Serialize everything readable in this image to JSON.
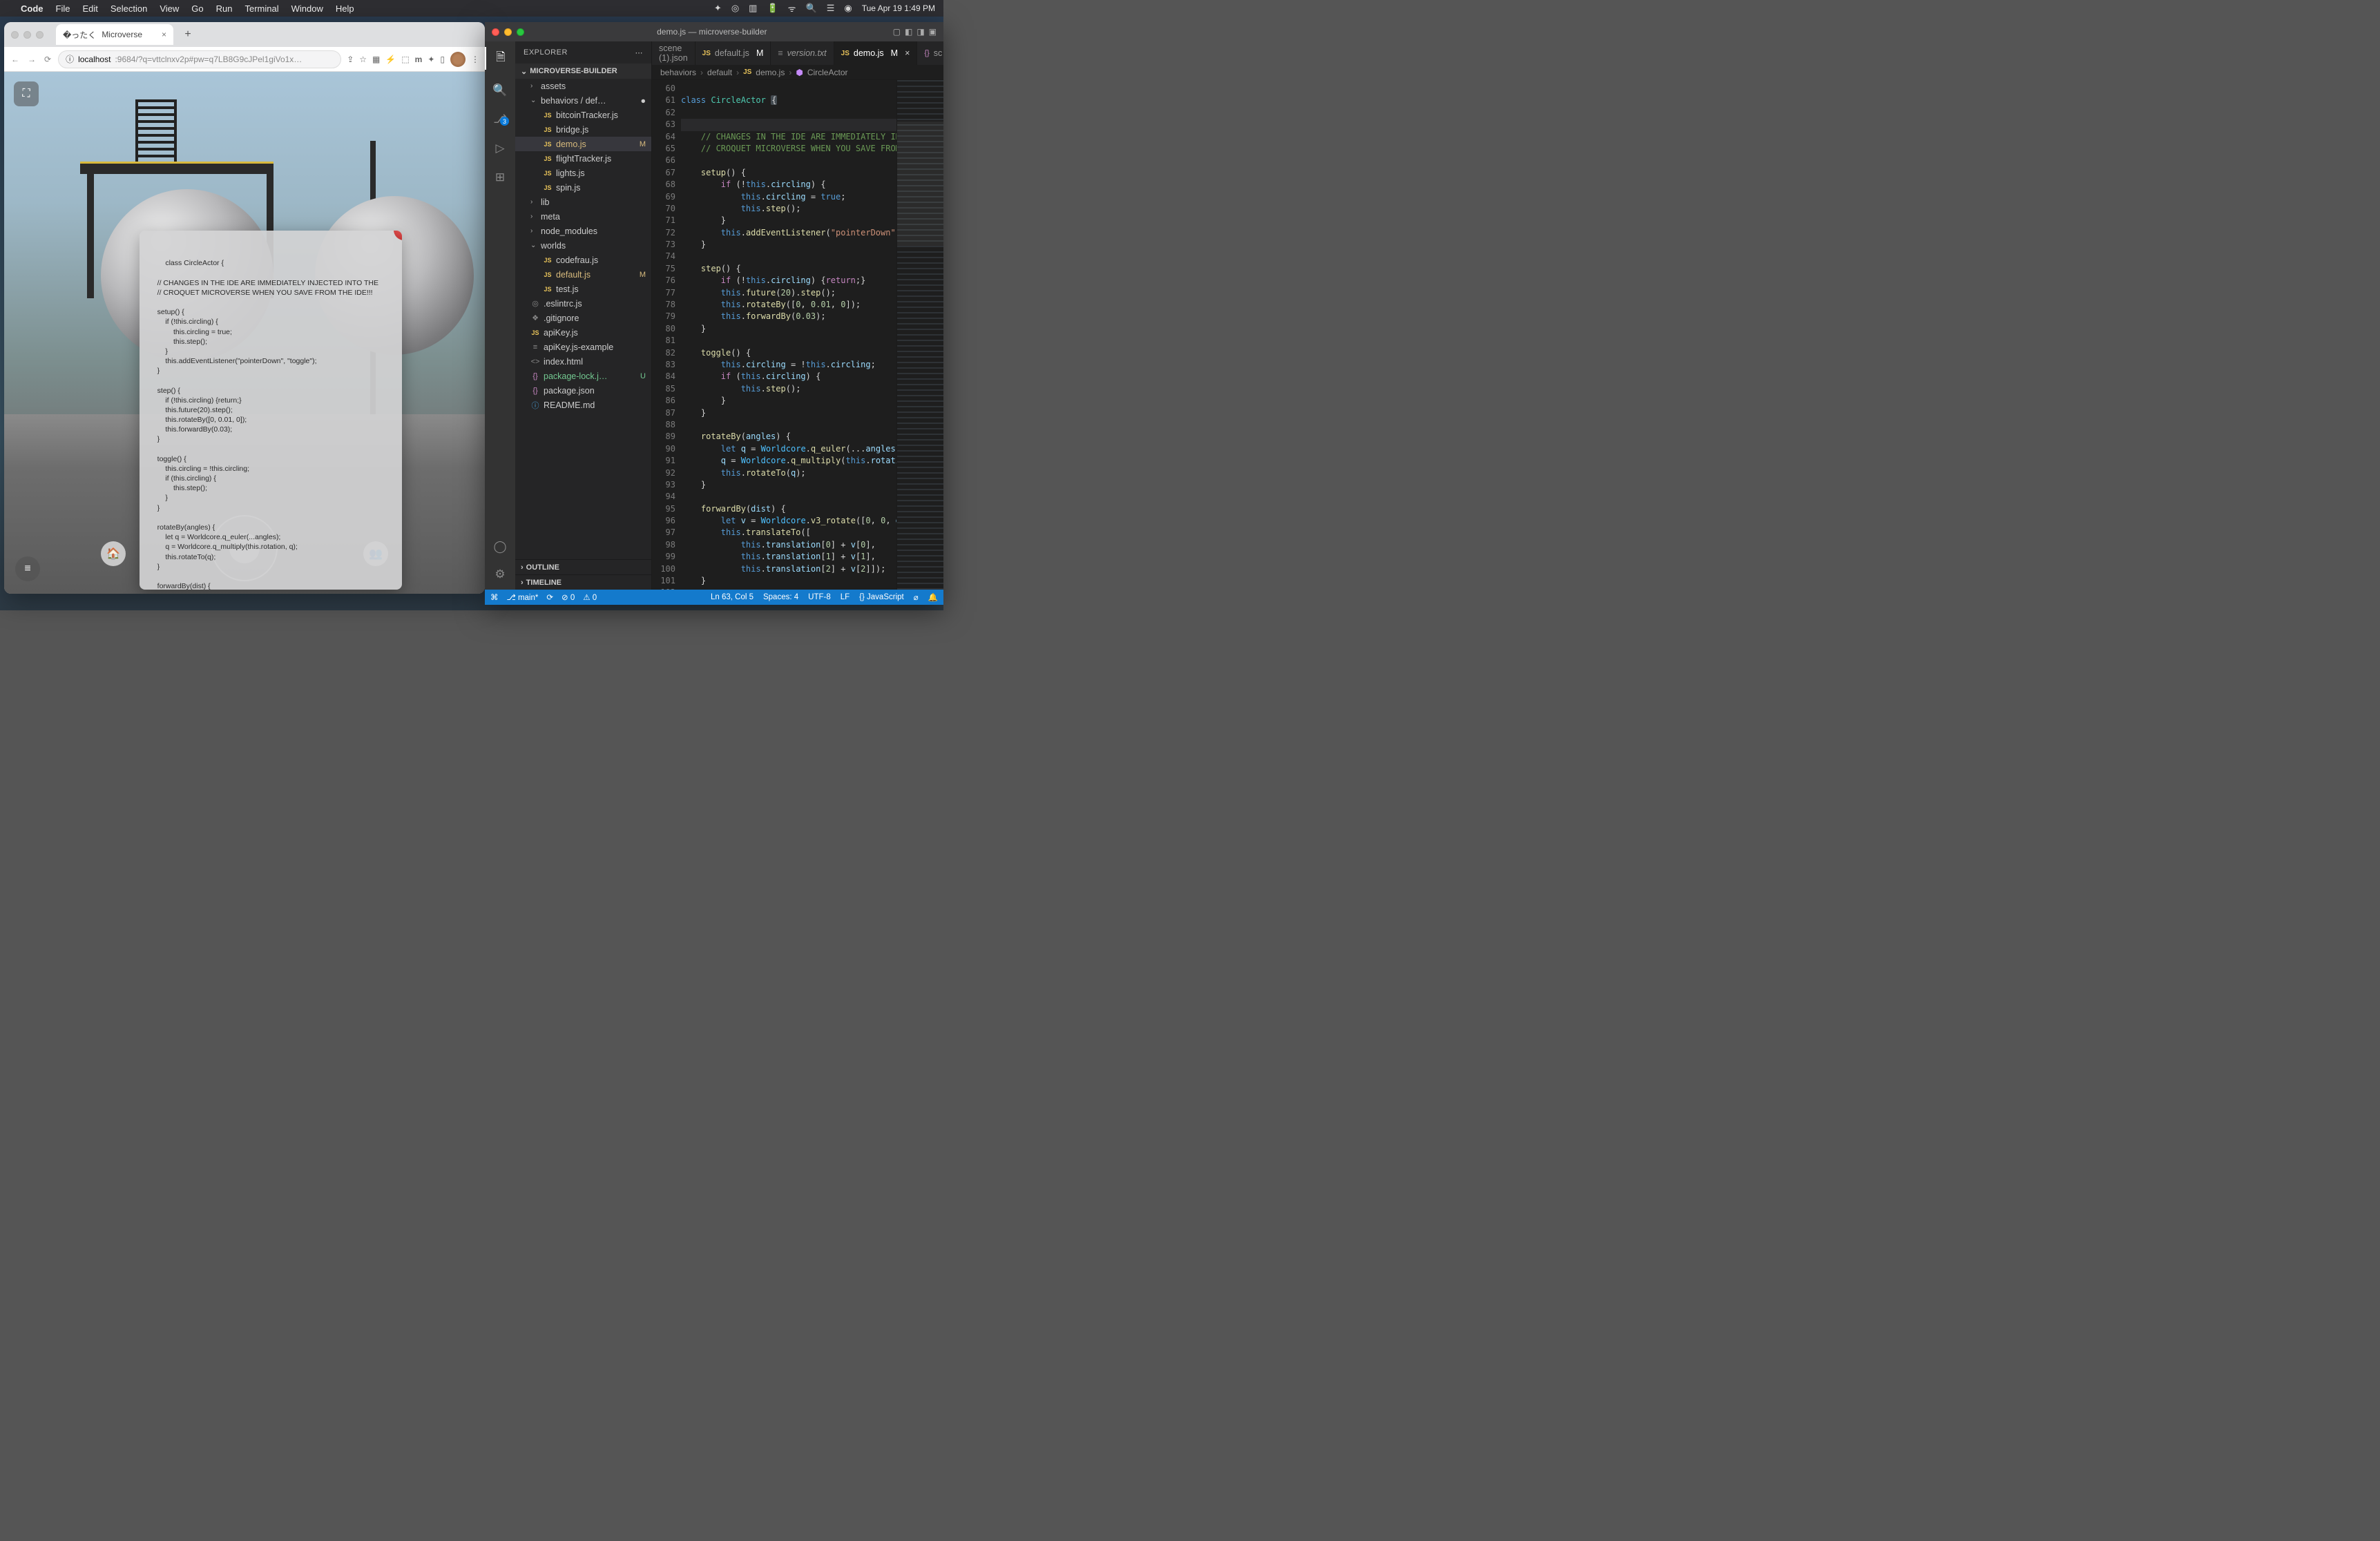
{
  "menubar": {
    "app": "Code",
    "items": [
      "File",
      "Edit",
      "Selection",
      "View",
      "Go",
      "Run",
      "Terminal",
      "Window",
      "Help"
    ],
    "clock": "Tue Apr 19  1:49 PM"
  },
  "browser": {
    "tab_title": "Microverse",
    "url_host": "localhost",
    "url_rest": ":9684/?q=vttclnxv2p#pw=q7LB8G9cJPel1giVo1x…",
    "codecard": "class CircleActor {\n\n    // CHANGES IN THE IDE ARE IMMEDIATELY INJECTED INTO THE\n    // CROQUET MICROVERSE WHEN YOU SAVE FROM THE IDE!!!\n\n    setup() {\n        if (!this.circling) {\n            this.circling = true;\n            this.step();\n        }\n        this.addEventListener(\"pointerDown\", \"toggle\");\n    }\n\n    step() {\n        if (!this.circling) {return;}\n        this.future(20).step();\n        this.rotateBy([0, 0.01, 0]);\n        this.forwardBy(0.03);\n    }\n\n    toggle() {\n        this.circling = !this.circling;\n        if (this.circling) {\n            this.step();\n        }\n    }\n\n    rotateBy(angles) {\n        let q = Worldcore.q_euler(...angles);\n        q = Worldcore.q_multiply(this.rotation, q);\n        this.rotateTo(q);\n    }\n\n    forwardBy(dist) {\n        let v = Worldcore.v3_rotate([0, 0, dist], this.rotation)\n        this.translateTo([\n            this.translation[0] + v[0],\n            this.translation[1] + v[1],\n            this.translation[2] + v[2]]);\n    }\n\n    destroy() {\n        this.removeEventListener(\"pointerDown\", \"toggle\");\n        this.circling = false;"
  },
  "vscode": {
    "title": "demo.js — microverse-builder",
    "sidebar_title": "EXPLORER",
    "project": "MICROVERSE-BUILDER",
    "tree": {
      "assets": "assets",
      "behaviors_path": "behaviors / def…",
      "files_behaviors": [
        {
          "name": "bitcoinTracker.js"
        },
        {
          "name": "bridge.js"
        },
        {
          "name": "demo.js",
          "status": "M",
          "active": true
        },
        {
          "name": "flightTracker.js"
        },
        {
          "name": "lights.js"
        },
        {
          "name": "spin.js"
        }
      ],
      "lib": "lib",
      "meta": "meta",
      "node_modules": "node_modules",
      "worlds": "worlds",
      "files_worlds": [
        {
          "name": "codefrau.js"
        },
        {
          "name": "default.js",
          "status": "M"
        },
        {
          "name": "test.js"
        }
      ],
      "root_files": [
        {
          "name": ".eslintrc.js",
          "icon": "eslint"
        },
        {
          "name": ".gitignore",
          "icon": "file"
        },
        {
          "name": "apiKey.js",
          "icon": "js"
        },
        {
          "name": "apiKey.js-example",
          "icon": "file"
        },
        {
          "name": "index.html",
          "icon": "html"
        },
        {
          "name": "package-lock.j…",
          "icon": "json",
          "status": "U"
        },
        {
          "name": "package.json",
          "icon": "json"
        },
        {
          "name": "README.md",
          "icon": "info"
        }
      ],
      "outline": "OUTLINE",
      "timeline": "TIMELINE"
    },
    "tabs": [
      {
        "label": "scene (1).json",
        "icon": "json"
      },
      {
        "label": "default.js",
        "icon": "js",
        "status": "M"
      },
      {
        "label": "version.txt",
        "icon": "file",
        "italic": true
      },
      {
        "label": "demo.js",
        "icon": "js",
        "status": "M",
        "active": true,
        "close": true
      },
      {
        "label": "sc",
        "icon": "json"
      }
    ],
    "breadcrumb": {
      "a": "behaviors",
      "b": "default",
      "c": "demo.js",
      "d": "CircleActor"
    },
    "gutter_start": 60,
    "status": {
      "branch": "main*",
      "sync": "⟳",
      "errors": "⊘ 0",
      "warnings": "⚠ 0",
      "lncol": "Ln 63, Col 5",
      "spaces": "Spaces: 4",
      "enc": "UTF-8",
      "eol": "LF",
      "lang": "{} JavaScript",
      "feedback": "⌀",
      "bell": "🔔"
    }
  }
}
